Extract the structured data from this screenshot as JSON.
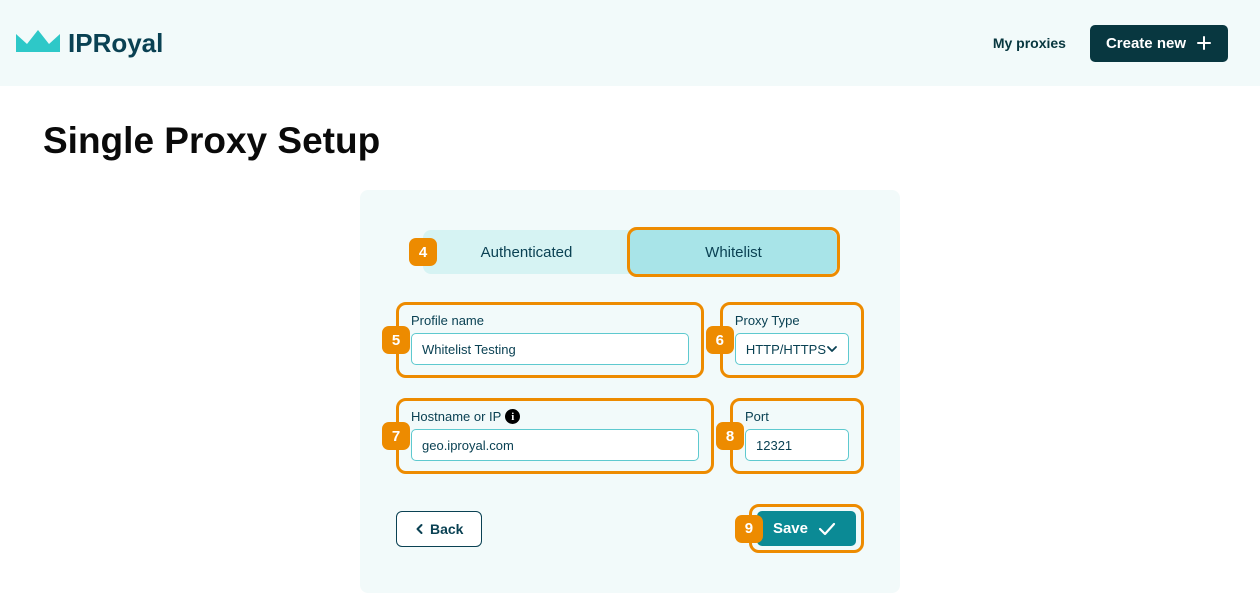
{
  "topbar": {
    "brand": "IPRoyal",
    "my_proxies": "My proxies",
    "create_new": "Create new"
  },
  "page": {
    "title": "Single Proxy Setup"
  },
  "tabs": {
    "authenticated": "Authenticated",
    "whitelist": "Whitelist"
  },
  "fields": {
    "profile_name": {
      "label": "Profile name",
      "value": "Whitelist Testing"
    },
    "proxy_type": {
      "label": "Proxy Type",
      "value": "HTTP/HTTPS"
    },
    "hostname": {
      "label": "Hostname or IP",
      "value": "geo.iproyal.com"
    },
    "port": {
      "label": "Port",
      "value": "12321"
    }
  },
  "buttons": {
    "back": "Back",
    "save": "Save"
  },
  "badges": {
    "b4": "4",
    "b5": "5",
    "b6": "6",
    "b7": "7",
    "b8": "8",
    "b9": "9"
  }
}
